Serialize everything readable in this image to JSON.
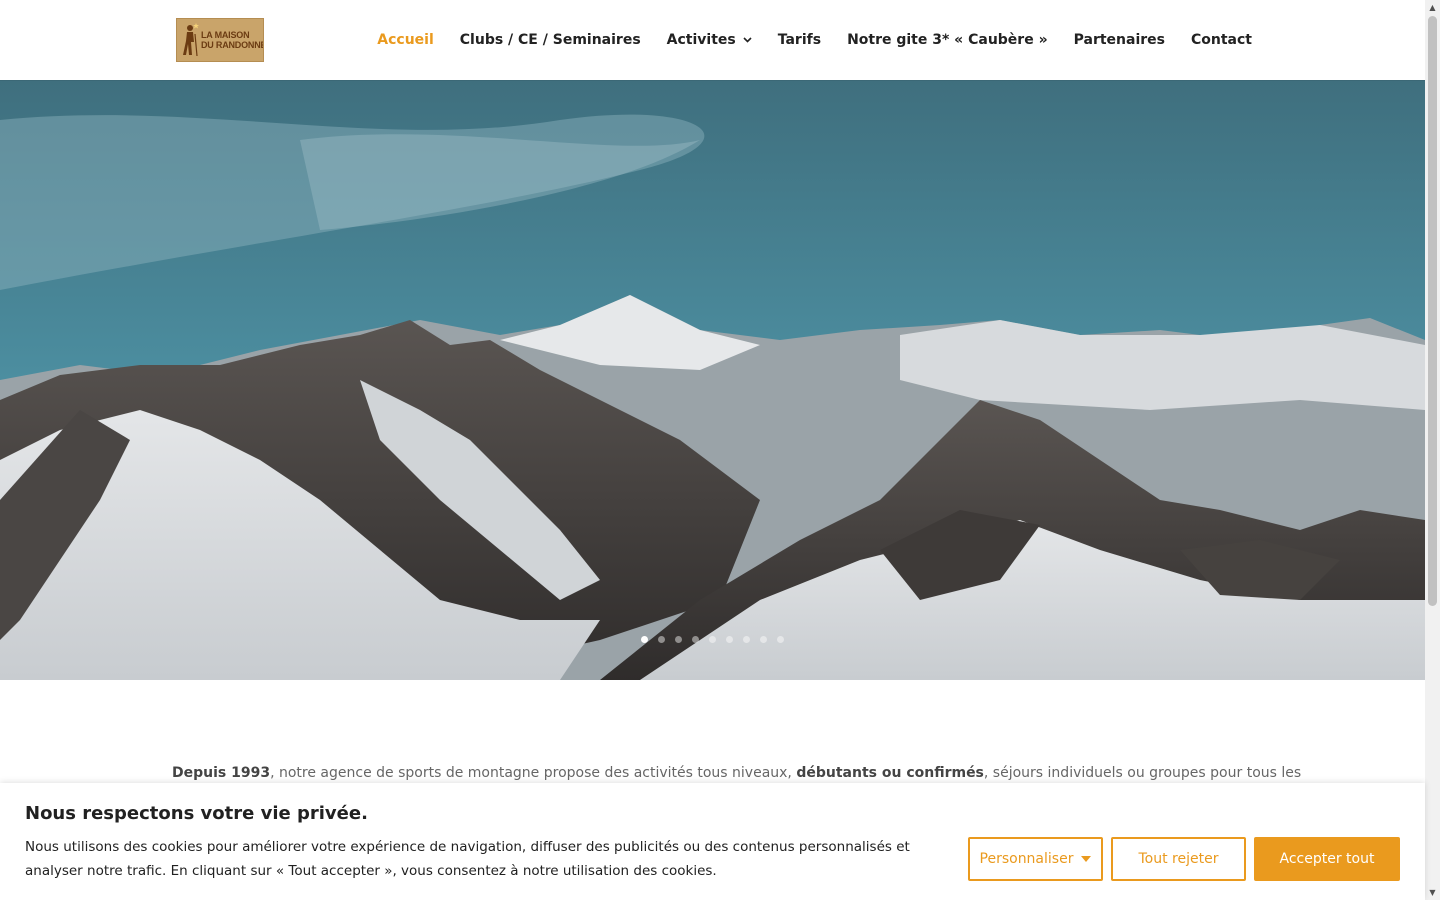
{
  "colors": {
    "accent": "#ea9a1e",
    "nav_text": "#222222",
    "body_text": "#666666"
  },
  "logo": {
    "line1": "LA MAISON",
    "line2": "DU RANDONNEUR"
  },
  "nav": {
    "items": [
      {
        "label": "Accueil",
        "active": true
      },
      {
        "label": "Clubs / CE / Seminaires"
      },
      {
        "label": "Activites",
        "has_dropdown": true
      },
      {
        "label": "Tarifs"
      },
      {
        "label": "Notre gite 3* « Caubère »"
      },
      {
        "label": "Partenaires"
      },
      {
        "label": "Contact"
      }
    ],
    "caret": "⌄"
  },
  "slider": {
    "slide_count": 9,
    "active_index": 0
  },
  "intro": {
    "bold1": "Depuis 1993",
    "text1": ", notre agence de sports de montagne propose des activités tous niveaux, ",
    "bold2": "débutants ou confirmés",
    "text2": ", séjours individuels ou groupes pour tous les"
  },
  "cookie": {
    "title": "Nous respectons votre vie privée.",
    "text": "Nous utilisons des cookies pour améliorer votre expérience de navigation, diffuser des publicités ou des contenus personnalisés et analyser notre trafic. En cliquant sur « Tout accepter », vous consentez à notre utilisation des cookies.",
    "customize_label": "Personnaliser",
    "reject_label": "Tout rejeter",
    "accept_label": "Accepter tout"
  }
}
